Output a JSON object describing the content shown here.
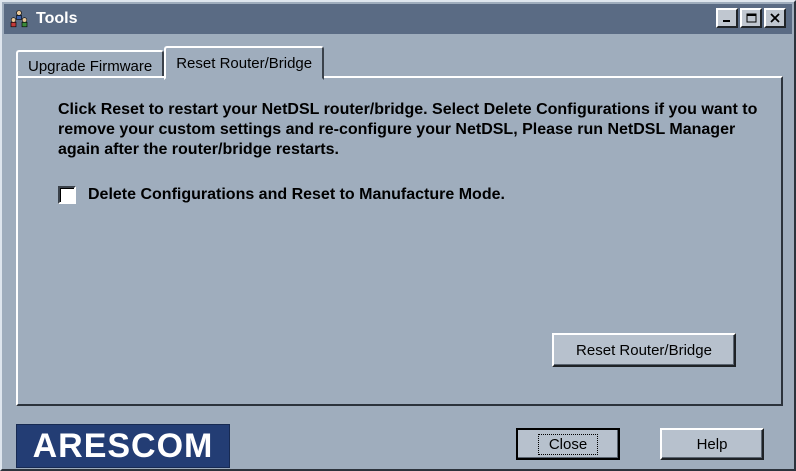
{
  "window": {
    "title": "Tools",
    "icon": "network-people-icon",
    "controls": [
      "minimize-icon",
      "maximize-icon",
      "close-icon"
    ]
  },
  "tabs": [
    {
      "label": "Upgrade Firmware",
      "active": false
    },
    {
      "label": "Reset Router/Bridge",
      "active": true
    }
  ],
  "panel": {
    "description": "Click Reset to restart your NetDSL router/bridge. Select Delete Configurations if you want to remove your custom settings and re-configure your NetDSL, Please run NetDSL Manager again after the router/bridge restarts.",
    "checkbox": {
      "label": "Delete Configurations and Reset to Manufacture Mode.",
      "checked": false
    },
    "reset_button": "Reset Router/Bridge"
  },
  "footer": {
    "logo_text": "ARESCOM",
    "close_button": "Close",
    "help_button": "Help"
  },
  "colors": {
    "window_bg": "#9fadbd",
    "titlebar": "#5a6b84",
    "logo_bg": "#233d74"
  }
}
